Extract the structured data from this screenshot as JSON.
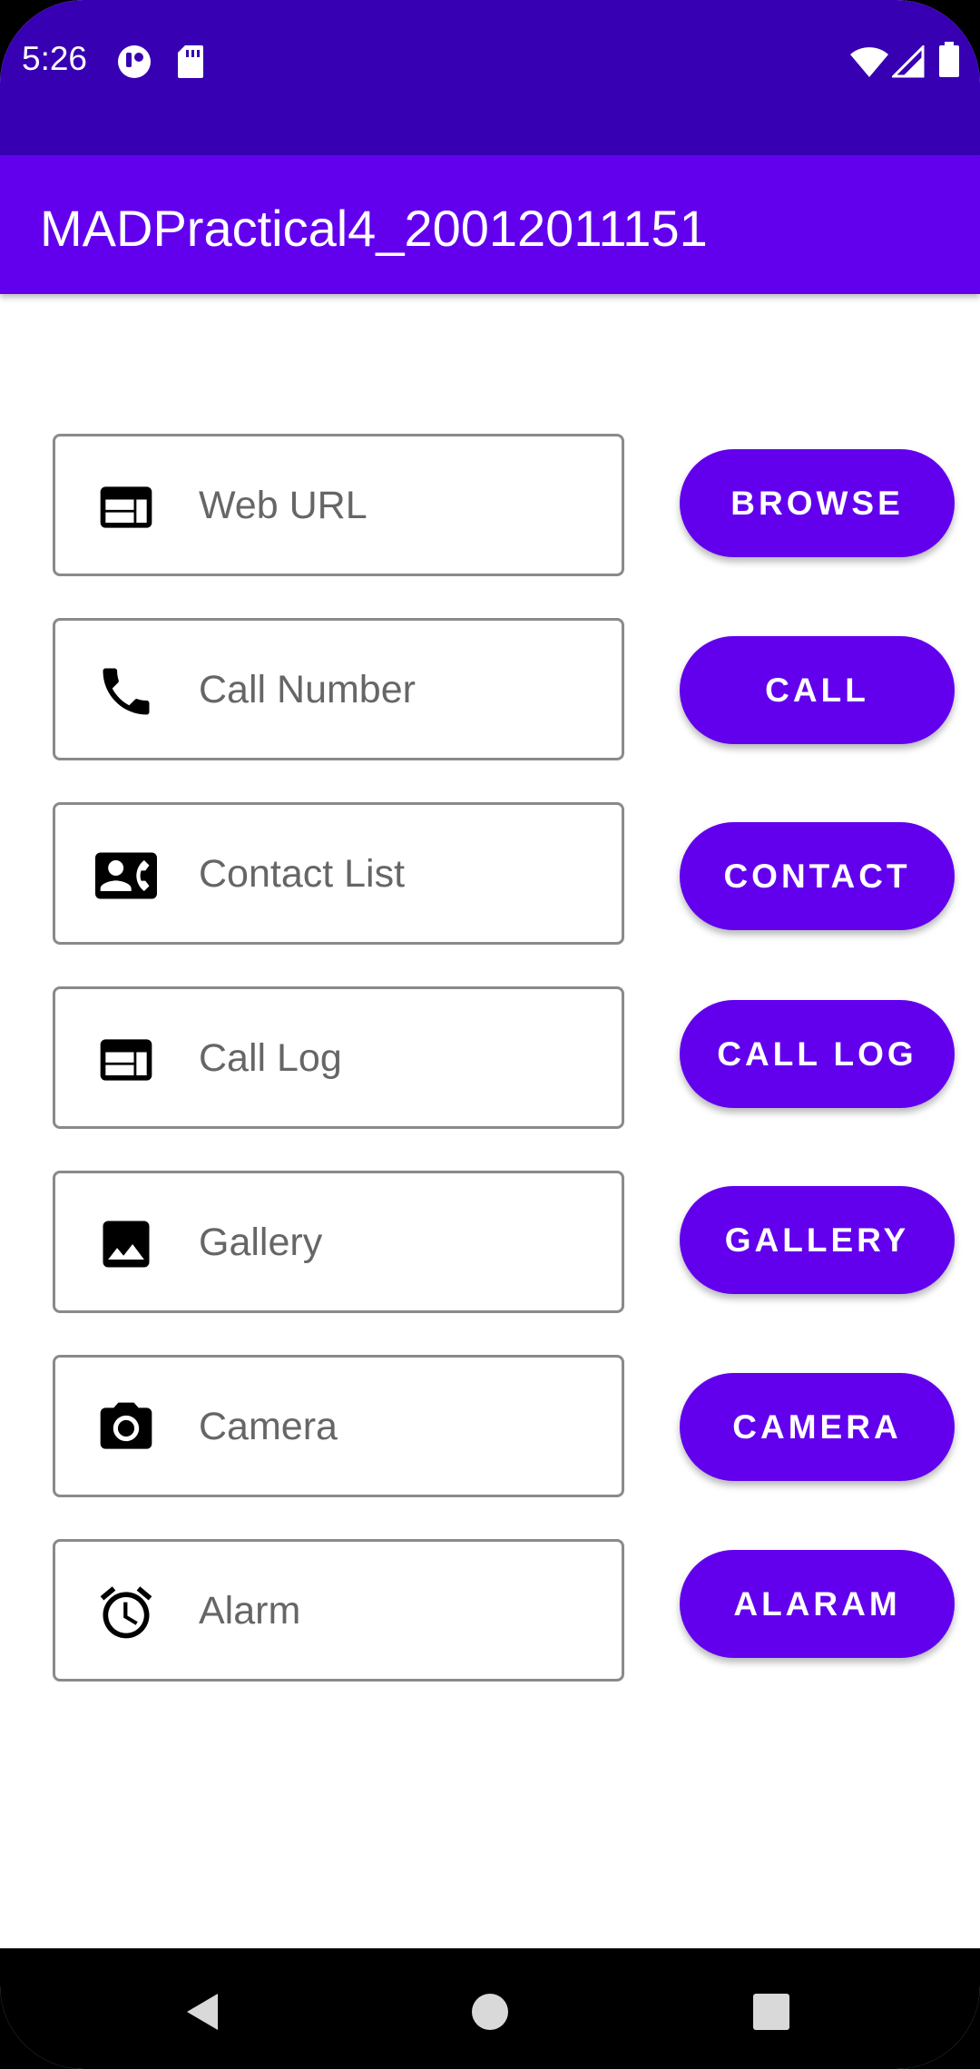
{
  "status_bar": {
    "time": "5:26",
    "left_icons": [
      "notification-app-icon",
      "sd-card-icon"
    ],
    "right_icons": [
      "wifi-icon",
      "signal-icon",
      "battery-icon"
    ]
  },
  "app_bar": {
    "title": "MADPractical4_20012011151"
  },
  "rows": [
    {
      "icon": "web-icon",
      "placeholder": "Web URL",
      "value": "",
      "button": "BROWSE"
    },
    {
      "icon": "phone-icon",
      "placeholder": "Call Number",
      "value": "",
      "button": "CALL"
    },
    {
      "icon": "contact-card-icon",
      "placeholder": "Contact List",
      "value": "",
      "button": "CONTACT"
    },
    {
      "icon": "web-icon",
      "placeholder": "Call Log",
      "value": "",
      "button": "CALL LOG"
    },
    {
      "icon": "image-icon",
      "placeholder": "Gallery",
      "value": "",
      "button": "GALLERY"
    },
    {
      "icon": "camera-icon",
      "placeholder": "Camera",
      "value": "",
      "button": "CAMERA"
    },
    {
      "icon": "alarm-icon",
      "placeholder": "Alarm",
      "value": "",
      "button": "ALARAM"
    }
  ],
  "nav_bar": {
    "buttons": [
      "back-icon",
      "home-icon",
      "recents-icon"
    ]
  },
  "colors": {
    "status_bar": "#3700b3",
    "primary": "#6200ee",
    "on_primary": "#ffffff",
    "field_border": "#8a8a8a",
    "placeholder_text": "#666666"
  }
}
